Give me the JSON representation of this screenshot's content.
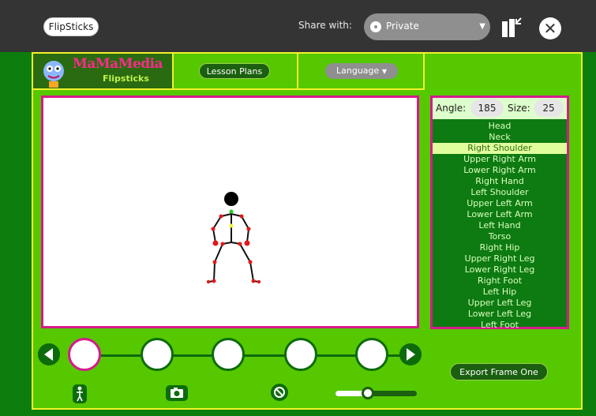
{
  "toolbar": {
    "activity_title": "FlipSticks",
    "share_label": "Share with:",
    "share_value": "Private"
  },
  "header": {
    "logo_title": "MaMaMedia",
    "logo_subtitle": "Flipsticks",
    "lesson_plans_label": "Lesson Plans",
    "language_label": "Language"
  },
  "joint_controls": {
    "angle_label": "Angle:",
    "angle_value": "185",
    "size_label": "Size:",
    "size_value": "25"
  },
  "parts": [
    {
      "label": "Head",
      "selected": false
    },
    {
      "label": "Neck",
      "selected": false
    },
    {
      "label": "Right Shoulder",
      "selected": true
    },
    {
      "label": "Upper Right Arm",
      "selected": false
    },
    {
      "label": "Lower Right Arm",
      "selected": false
    },
    {
      "label": "Right Hand",
      "selected": false
    },
    {
      "label": "Left Shoulder",
      "selected": false
    },
    {
      "label": "Upper Left Arm",
      "selected": false
    },
    {
      "label": "Lower Left Arm",
      "selected": false
    },
    {
      "label": "Left Hand",
      "selected": false
    },
    {
      "label": "Torso",
      "selected": false
    },
    {
      "label": "Right Hip",
      "selected": false
    },
    {
      "label": "Upper Right Leg",
      "selected": false
    },
    {
      "label": "Lower Right Leg",
      "selected": false
    },
    {
      "label": "Right Foot",
      "selected": false
    },
    {
      "label": "Left Hip",
      "selected": false
    },
    {
      "label": "Upper Left Leg",
      "selected": false
    },
    {
      "label": "Lower Left Leg",
      "selected": false
    },
    {
      "label": "Left Foot",
      "selected": false
    }
  ],
  "frames": {
    "count": 5,
    "current_index": 0,
    "export_label": "Export Frame One"
  },
  "icons": {
    "prev": "left-arrow-icon",
    "next": "right-arrow-icon",
    "reset_figure": "stick-figure-icon",
    "capture": "camera-icon",
    "clear": "no-symbol-icon",
    "keep": "journal-keep-icon",
    "stop": "stop-icon"
  },
  "speed_slider": {
    "value": 0.4
  },
  "colors": {
    "panel": "#55c800",
    "background": "#0d7e0d",
    "border": "#f2f22a",
    "accent": "#d61a8d",
    "selected_row": "#e0ff9c"
  }
}
